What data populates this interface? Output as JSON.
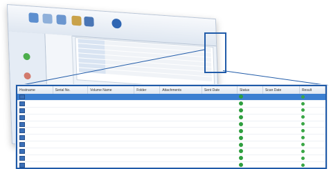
{
  "columns": [
    "Hostname",
    "Serial No.",
    "Volume Name",
    "Folder",
    "Attachments",
    "Sent Date",
    "Status",
    "Scan Date",
    "Result"
  ],
  "rows": [
    {
      "host": "",
      "serial": "",
      "vol": "",
      "folder": "",
      "attach": "",
      "size": "",
      "date": "",
      "res": "",
      "selected": true
    },
    {
      "host": "",
      "serial": "",
      "vol": "",
      "folder": "",
      "attach": "",
      "size": "",
      "date": "",
      "res": "",
      "selected": false
    },
    {
      "host": "",
      "serial": "",
      "vol": "",
      "folder": "",
      "attach": "",
      "size": "",
      "date": "",
      "res": "",
      "selected": false
    },
    {
      "host": "",
      "serial": "",
      "vol": "",
      "folder": "",
      "attach": "",
      "size": "",
      "date": "",
      "res": "",
      "selected": false
    },
    {
      "host": "",
      "serial": "",
      "vol": "",
      "folder": "",
      "attach": "",
      "size": "",
      "date": "",
      "res": "",
      "selected": false
    },
    {
      "host": "",
      "serial": "",
      "vol": "",
      "folder": "",
      "attach": "",
      "size": "",
      "date": "",
      "res": "",
      "selected": false
    },
    {
      "host": "",
      "serial": "",
      "vol": "",
      "folder": "",
      "attach": "",
      "size": "",
      "date": "",
      "res": "",
      "selected": false
    },
    {
      "host": "",
      "serial": "",
      "vol": "",
      "folder": "",
      "attach": "",
      "size": "",
      "date": "",
      "res": "",
      "selected": false
    },
    {
      "host": "",
      "serial": "",
      "vol": "",
      "folder": "",
      "attach": "",
      "size": "",
      "date": "",
      "res": "",
      "selected": false
    },
    {
      "host": "",
      "serial": "",
      "vol": "",
      "folder": "",
      "attach": "",
      "size": "",
      "date": "",
      "res": "",
      "selected": false
    },
    {
      "host": "",
      "serial": "",
      "vol": "",
      "folder": "",
      "attach": "",
      "size": "",
      "date": "",
      "res": "",
      "selected": false
    }
  ],
  "colors": {
    "accent": "#1f5aa8",
    "selection": "#3b7fd1",
    "status_ok": "#2e9e3e"
  },
  "icons": {
    "row_icon": "document-icon",
    "status_icon": "green-status-icon",
    "result_icon": "check-circle-icon"
  }
}
